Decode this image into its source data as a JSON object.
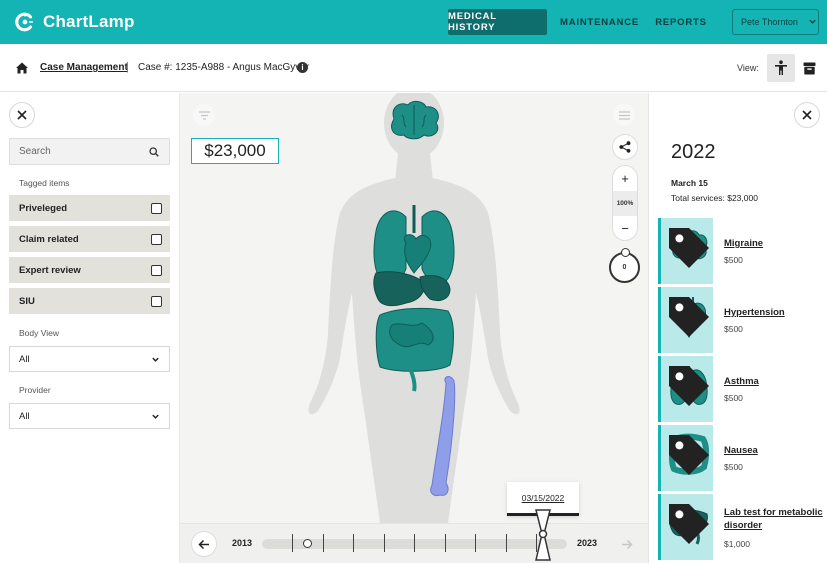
{
  "app": {
    "name": "ChartLamp"
  },
  "colors": {
    "brand": "#14b4b4",
    "brand_dark": "#0e6e6e",
    "organ": "#1e8f86",
    "highlight": "#8f9ee8"
  },
  "nav": {
    "items": [
      {
        "label": "MEDICAL HISTORY",
        "active": true
      },
      {
        "label": "MAINTENANCE",
        "active": false
      },
      {
        "label": "REPORTS",
        "active": false
      }
    ],
    "user": "Pete Thornton"
  },
  "breadcrumb": {
    "root": "Case Management",
    "case": "Case #: 1235-A988 - Angus MacGyver"
  },
  "view": {
    "label": "View:"
  },
  "filters": {
    "search_placeholder": "Search",
    "tagged_label": "Tagged items",
    "tags": [
      "Priveleged",
      "Claim related",
      "Expert review",
      "SIU"
    ],
    "body_view": {
      "label": "Body View",
      "value": "All"
    },
    "provider": {
      "label": "Provider",
      "value": "All"
    }
  },
  "center": {
    "amount": "$23,000",
    "zoom": "100%",
    "rotation": "0"
  },
  "timeline": {
    "start_year": "2013",
    "end_year": "2023",
    "selected_date": "03/15/2022",
    "selected_fraction": 0.92
  },
  "details": {
    "year": "2022",
    "date": "March 15",
    "total": "Total services: $23,000",
    "services": [
      {
        "name": "Migraine",
        "cost": "$500",
        "icon": "brain-icon"
      },
      {
        "name": "Hypertension",
        "cost": "$500",
        "icon": "heart-icon"
      },
      {
        "name": "Asthma",
        "cost": "$500",
        "icon": "lungs-icon"
      },
      {
        "name": "Nausea",
        "cost": "$500",
        "icon": "intestine-icon"
      },
      {
        "name": "Lab test for metabolic disorder",
        "cost": "$1,000",
        "icon": "liver-icon"
      }
    ]
  }
}
